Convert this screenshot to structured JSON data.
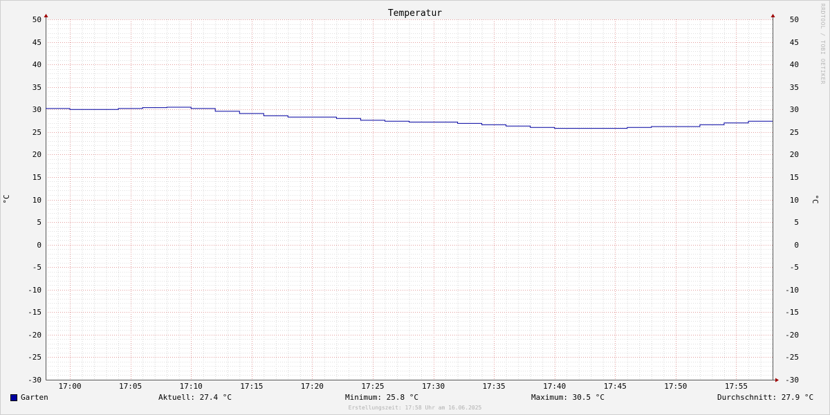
{
  "watermark": "RRDTOOL / TOBI OETIKER",
  "chart_data": {
    "type": "line",
    "title": "Temperatur",
    "ylabel": "°C",
    "ylabel_right": "°C",
    "ylim": [
      -30,
      50
    ],
    "yticks": [
      50,
      45,
      40,
      35,
      30,
      25,
      20,
      15,
      10,
      5,
      0,
      -5,
      -10,
      -15,
      -20,
      -25,
      -30
    ],
    "xlim": [
      "16:58",
      "17:58"
    ],
    "xticks": [
      "17:00",
      "17:05",
      "17:10",
      "17:15",
      "17:20",
      "17:25",
      "17:30",
      "17:35",
      "17:40",
      "17:45",
      "17:50",
      "17:55"
    ],
    "grid": true,
    "line_style": "step",
    "series": [
      {
        "name": "Garten",
        "color": "#0000a0",
        "points": [
          [
            "16:58",
            30.2
          ],
          [
            "17:00",
            30.0
          ],
          [
            "17:04",
            30.2
          ],
          [
            "17:06",
            30.4
          ],
          [
            "17:08",
            30.5
          ],
          [
            "17:10",
            30.2
          ],
          [
            "17:12",
            29.6
          ],
          [
            "17:14",
            29.1
          ],
          [
            "17:16",
            28.6
          ],
          [
            "17:18",
            28.3
          ],
          [
            "17:22",
            28.0
          ],
          [
            "17:24",
            27.6
          ],
          [
            "17:26",
            27.4
          ],
          [
            "17:28",
            27.2
          ],
          [
            "17:32",
            26.9
          ],
          [
            "17:34",
            26.6
          ],
          [
            "17:36",
            26.3
          ],
          [
            "17:38",
            26.0
          ],
          [
            "17:40",
            25.8
          ],
          [
            "17:46",
            26.0
          ],
          [
            "17:48",
            26.2
          ],
          [
            "17:52",
            26.6
          ],
          [
            "17:54",
            27.0
          ],
          [
            "17:56",
            27.4
          ],
          [
            "17:58",
            27.4
          ]
        ]
      }
    ]
  },
  "legend": {
    "series_name": "Garten",
    "color": "#0000a0"
  },
  "stats": {
    "current": "Aktuell: 27.4 °C",
    "minimum": "Minimum: 25.8 °C",
    "maximum": "Maximum: 30.5 °C",
    "average": "Durchschnitt: 27.9 °C"
  },
  "creation_time": "Erstellungszeit: 17:58 Uhr am 16.06.2025"
}
